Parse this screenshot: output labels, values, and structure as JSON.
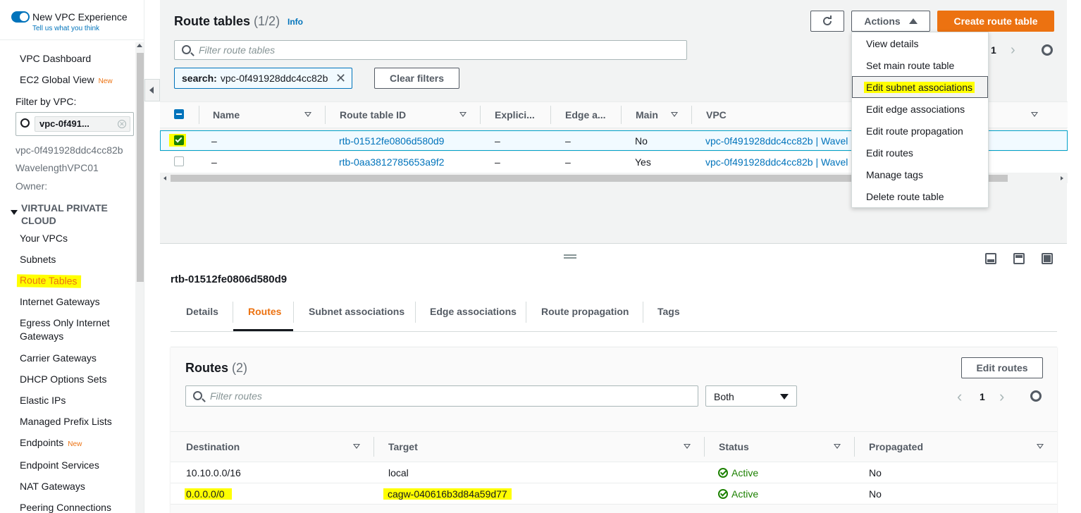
{
  "sidebar": {
    "experience_label": "New VPC Experience",
    "experience_sub": "Tell us what you think",
    "vpc_dashboard": "VPC Dashboard",
    "ec2_global_view": "EC2 Global View",
    "new_badge": "New",
    "filter_label": "Filter by VPC:",
    "filter_value": "vpc-0f491...",
    "vpc_id": "vpc-0f491928ddc4cc82b",
    "vpc_name": "WavelengthVPC01",
    "owner": "Owner:",
    "section_title_1": "VIRTUAL PRIVATE",
    "section_title_2": "CLOUD",
    "items": [
      "Your VPCs",
      "Subnets",
      "Route Tables",
      "Internet Gateways",
      "Egress Only Internet",
      "Gateways",
      "Carrier Gateways",
      "DHCP Options Sets",
      "Elastic IPs",
      "Managed Prefix Lists",
      "Endpoints",
      "Endpoint Services",
      "NAT Gateways",
      "Peering Connections"
    ]
  },
  "header": {
    "title": "Route tables",
    "count": "(1/2)",
    "info": "Info",
    "actions": "Actions",
    "create": "Create route table",
    "filter_placeholder": "Filter route tables",
    "token_key": "search:",
    "token_value": "vpc-0f491928ddc4cc82b",
    "clear_filters": "Clear filters",
    "page": "1"
  },
  "table": {
    "columns": [
      "Name",
      "Route table ID",
      "Explici...",
      "Edge a...",
      "Main",
      "VPC"
    ],
    "rows": [
      {
        "name": "–",
        "id": "rtb-01512fe0806d580d9",
        "explicit": "–",
        "edge": "–",
        "main": "No",
        "vpc": "vpc-0f491928ddc4cc82b | Wavel"
      },
      {
        "name": "–",
        "id": "rtb-0aa3812785653a9f2",
        "explicit": "–",
        "edge": "–",
        "main": "Yes",
        "vpc": "vpc-0f491928ddc4cc82b | Wavel"
      }
    ]
  },
  "menu": {
    "items": [
      "View details",
      "Set main route table",
      "Edit subnet associations",
      "Edit edge associations",
      "Edit route propagation",
      "Edit routes",
      "Manage tags",
      "Delete route table"
    ]
  },
  "detail": {
    "title": "rtb-01512fe0806d580d9",
    "tabs": [
      "Details",
      "Routes",
      "Subnet associations",
      "Edge associations",
      "Route propagation",
      "Tags"
    ],
    "routes_title": "Routes",
    "routes_count": "(2)",
    "edit_routes": "Edit routes",
    "filter_placeholder": "Filter routes",
    "select_value": "Both",
    "page": "1",
    "columns": [
      "Destination",
      "Target",
      "Status",
      "Propagated"
    ],
    "rows": [
      {
        "destination": "10.10.0.0/16",
        "target": "local",
        "status": "Active",
        "propagated": "No"
      },
      {
        "destination": "0.0.0.0/0",
        "target": "cagw-040616b3d84a59d77",
        "status": "Active",
        "propagated": "No"
      }
    ]
  },
  "colors": {
    "accent": "#0073bb",
    "primary": "#ec7211",
    "success": "#1d8102",
    "highlight": "#ffff00"
  }
}
